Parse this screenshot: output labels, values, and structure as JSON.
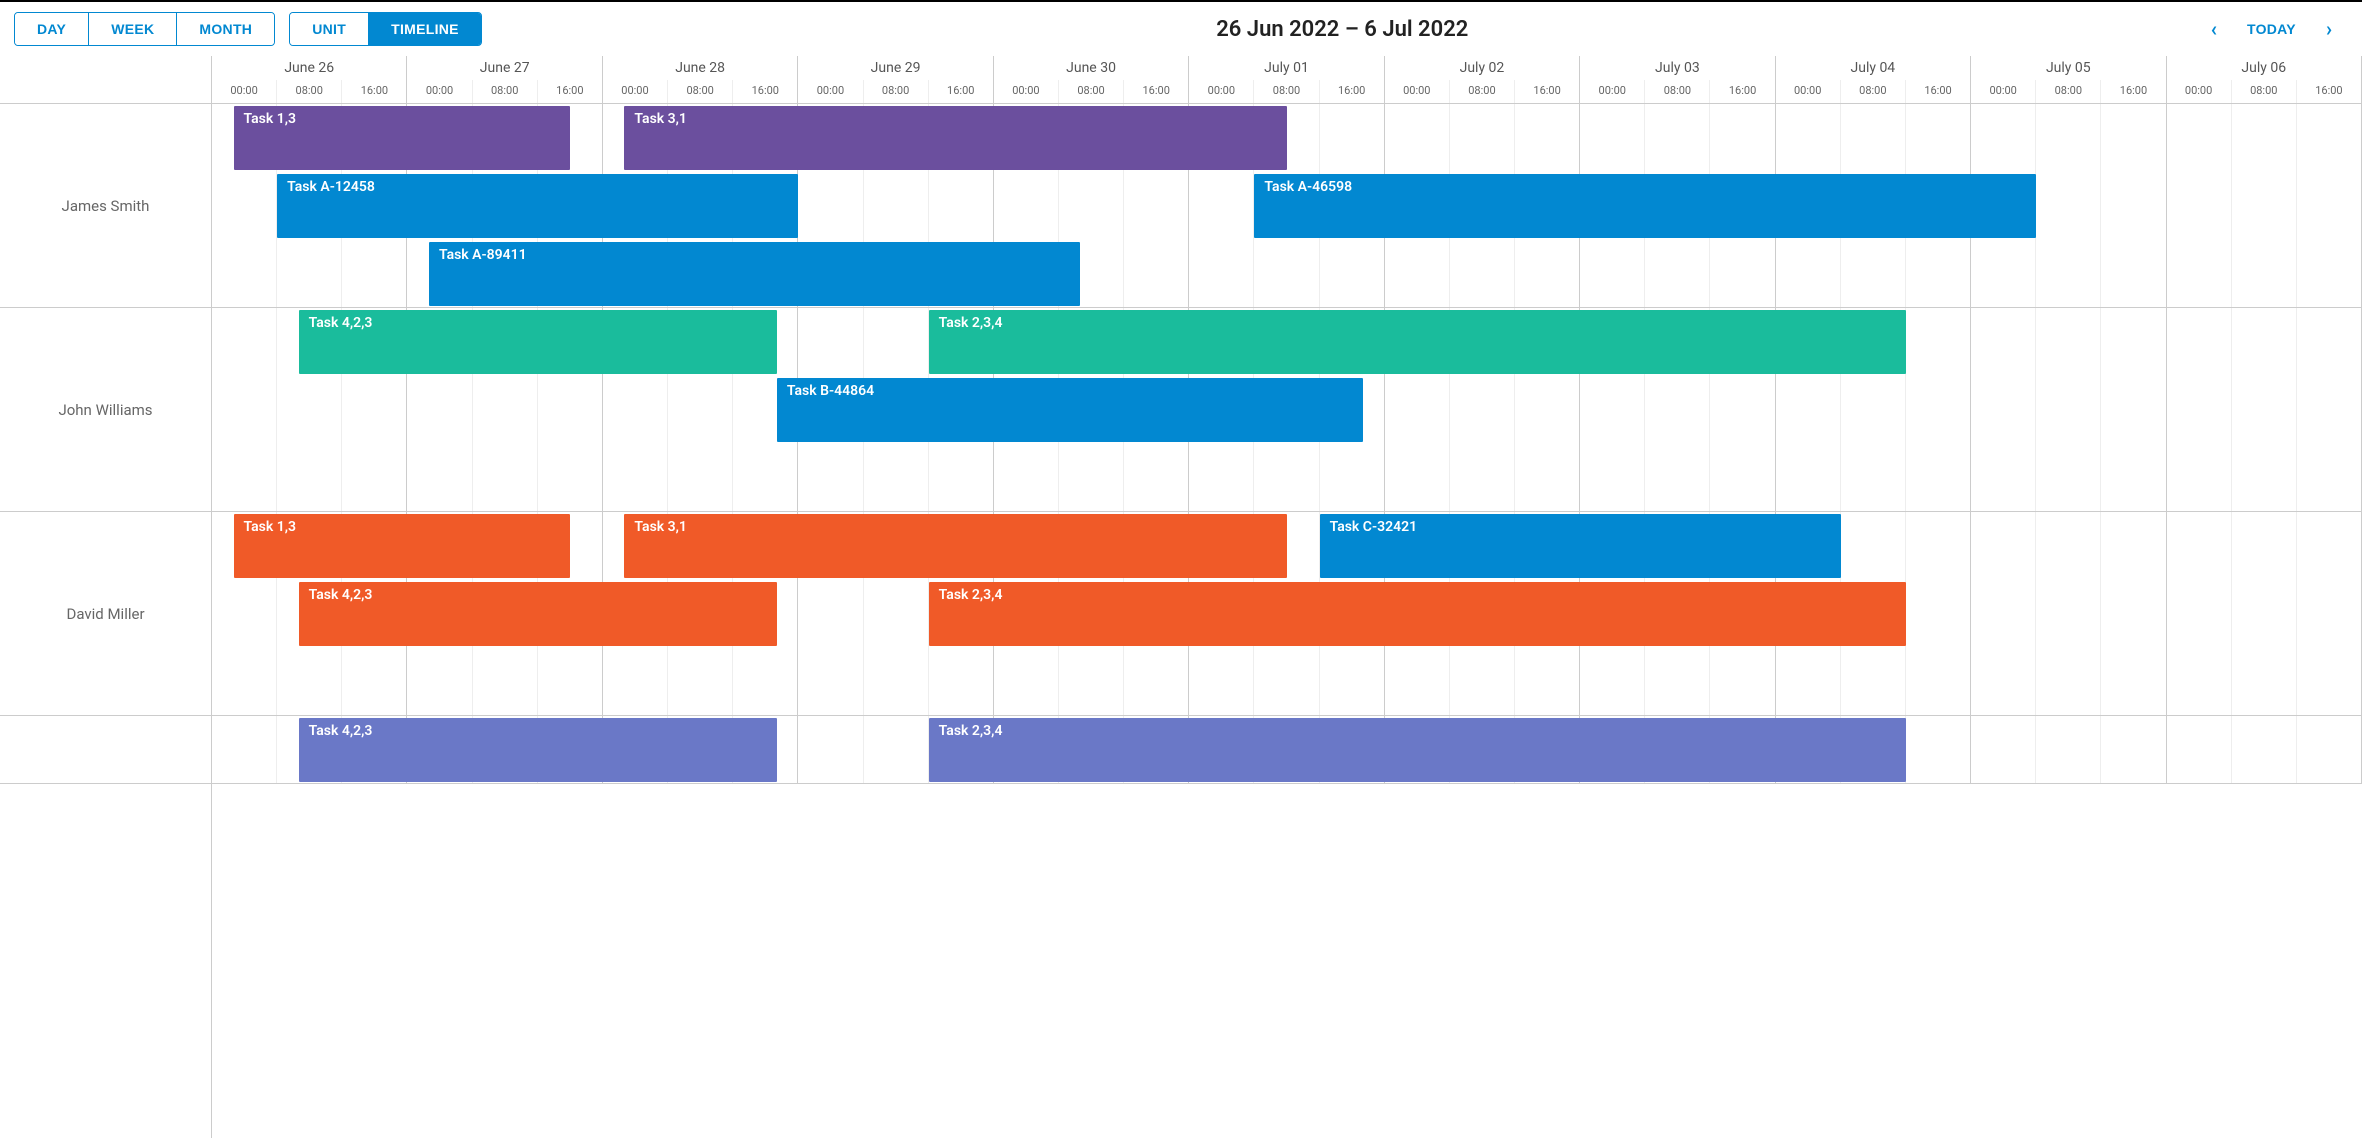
{
  "toolbar": {
    "view_group1": [
      {
        "label": "DAY",
        "active": false
      },
      {
        "label": "WEEK",
        "active": false
      },
      {
        "label": "MONTH",
        "active": false
      }
    ],
    "view_group2": [
      {
        "label": "UNIT",
        "active": false
      },
      {
        "label": "TIMELINE",
        "active": true
      }
    ],
    "title": "26 Jun 2022 – 6 Jul 2022",
    "today_label": "TODAY"
  },
  "timeline": {
    "num_days": 11,
    "hours_per_day": 3,
    "hour_labels": [
      "00:00",
      "08:00",
      "16:00"
    ],
    "days": [
      {
        "label": "June 26"
      },
      {
        "label": "June 27"
      },
      {
        "label": "June 28"
      },
      {
        "label": "June 29"
      },
      {
        "label": "June 30"
      },
      {
        "label": "July 01"
      },
      {
        "label": "July 02"
      },
      {
        "label": "July 03"
      },
      {
        "label": "July 04"
      },
      {
        "label": "July 05"
      },
      {
        "label": "July 06"
      }
    ]
  },
  "colors": {
    "purple": "#6b4f9e",
    "blue": "#0288d1",
    "teal": "#1abc9c",
    "orange": "#f05a28",
    "indigo": "#6a78c7"
  },
  "resources": [
    {
      "name": "James Smith",
      "lanes": 3,
      "events": [
        {
          "label": "Task 1,3",
          "color": "purple",
          "lane": 0,
          "start": 0.33,
          "end": 5.5
        },
        {
          "label": "Task 3,1",
          "color": "purple",
          "lane": 0,
          "start": 6.33,
          "end": 16.5
        },
        {
          "label": "Task A-12458",
          "color": "blue",
          "lane": 1,
          "start": 1.0,
          "end": 9.0
        },
        {
          "label": "Task A-46598",
          "color": "blue",
          "lane": 1,
          "start": 16.0,
          "end": 28.0
        },
        {
          "label": "Task A-89411",
          "color": "blue",
          "lane": 2,
          "start": 3.33,
          "end": 13.33
        }
      ]
    },
    {
      "name": "John Williams",
      "lanes": 3,
      "events": [
        {
          "label": "Task 4,2,3",
          "color": "teal",
          "lane": 0,
          "start": 1.33,
          "end": 8.67
        },
        {
          "label": "Task 2,3,4",
          "color": "teal",
          "lane": 0,
          "start": 11.0,
          "end": 26.0
        },
        {
          "label": "Task B-44864",
          "color": "blue",
          "lane": 1,
          "start": 8.67,
          "end": 17.67
        }
      ]
    },
    {
      "name": "David Miller",
      "lanes": 3,
      "events": [
        {
          "label": "Task 1,3",
          "color": "orange",
          "lane": 0,
          "start": 0.33,
          "end": 5.5
        },
        {
          "label": "Task 3,1",
          "color": "orange",
          "lane": 0,
          "start": 6.33,
          "end": 16.5
        },
        {
          "label": "Task C-32421",
          "color": "blue",
          "lane": 0,
          "start": 17.0,
          "end": 25.0
        },
        {
          "label": "Task 4,2,3",
          "color": "orange",
          "lane": 1,
          "start": 1.33,
          "end": 8.67
        },
        {
          "label": "Task 2,3,4",
          "color": "orange",
          "lane": 1,
          "start": 11.0,
          "end": 26.0
        }
      ]
    },
    {
      "name": "",
      "lanes": 1,
      "events": [
        {
          "label": "Task 4,2,3",
          "color": "indigo",
          "lane": 0,
          "start": 1.33,
          "end": 8.67
        },
        {
          "label": "Task 2,3,4",
          "color": "indigo",
          "lane": 0,
          "start": 11.0,
          "end": 26.0
        }
      ]
    }
  ],
  "layout": {
    "lane_height": 68,
    "event_height": 64
  }
}
